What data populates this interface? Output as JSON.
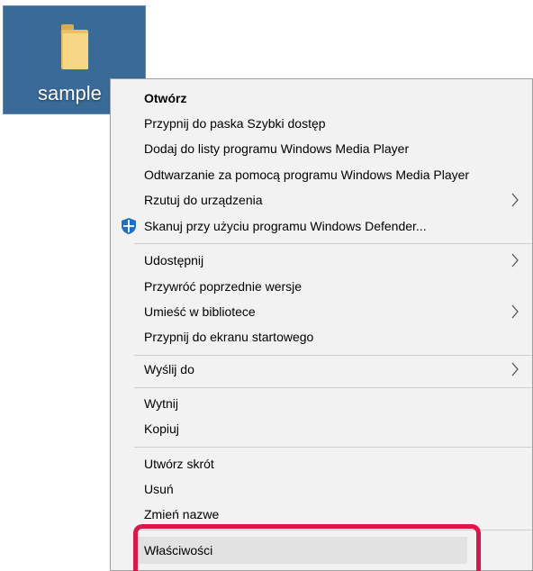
{
  "desktop": {
    "icon_label": "sample",
    "icon": "folder-icon"
  },
  "menu": {
    "items": [
      {
        "label": "Otwórz",
        "bold": true
      },
      {
        "label": "Przypnij do paska Szybki dostęp"
      },
      {
        "label": "Dodaj do listy programu Windows Media Player"
      },
      {
        "label": "Odtwarzanie za pomocą programu Windows Media Player"
      },
      {
        "label": "Rzutuj do urządzenia",
        "submenu": true
      },
      {
        "label": "Skanuj przy użyciu programu Windows Defender...",
        "icon": "windows-defender-shield-icon"
      },
      {
        "label": "Udostępnij",
        "submenu": true
      },
      {
        "label": "Przywróć poprzednie wersje"
      },
      {
        "label": "Umieść w bibliotece",
        "submenu": true
      },
      {
        "label": "Przypnij do ekranu startowego"
      },
      {
        "label": "Wyślij do",
        "submenu": true
      },
      {
        "label": "Wytnij"
      },
      {
        "label": "Kopiuj"
      },
      {
        "label": "Utwórz skrót"
      },
      {
        "label": "Usuń"
      },
      {
        "label": "Zmień nazwe"
      },
      {
        "label": "Właściwości",
        "hovered": true
      }
    ]
  },
  "colors": {
    "selection_bg": "#3a6a97",
    "menu_bg": "#f2f2f2",
    "highlight_border": "#d6184a",
    "shield_blue": "#1f6fc5"
  }
}
